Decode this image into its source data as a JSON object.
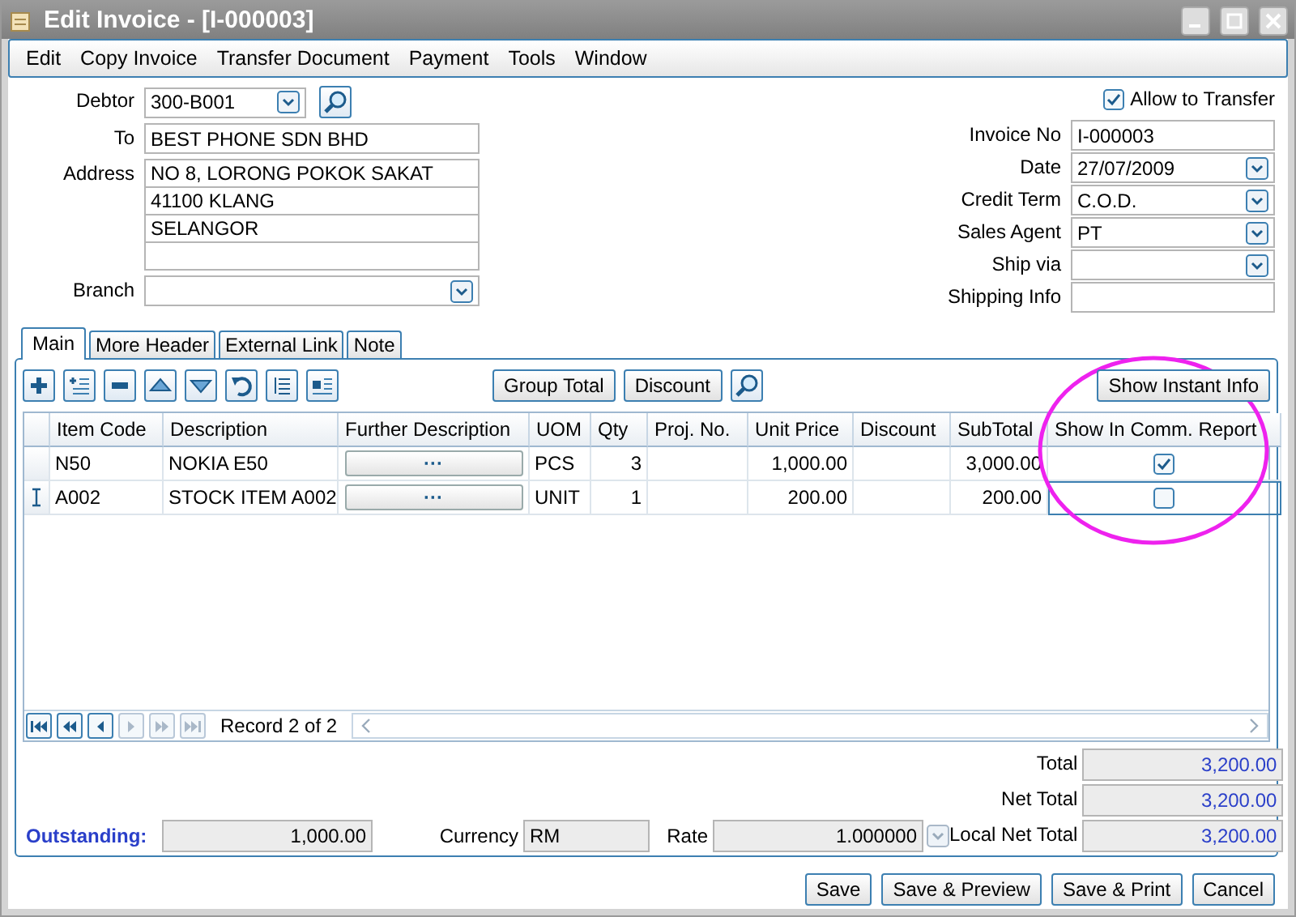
{
  "window": {
    "title": "Edit Invoice - [I-000003]"
  },
  "menu": [
    {
      "label": "Edit"
    },
    {
      "label": "Copy Invoice"
    },
    {
      "label": "Transfer Document"
    },
    {
      "label": "Payment"
    },
    {
      "label": "Tools"
    },
    {
      "label": "Window"
    }
  ],
  "header": {
    "debtor": {
      "label": "Debtor",
      "value": "300-B001"
    },
    "to": {
      "label": "To",
      "value": "BEST PHONE SDN BHD"
    },
    "address": {
      "label": "Address",
      "lines": [
        "NO 8, LORONG POKOK SAKAT",
        "41100 KLANG",
        "SELANGOR"
      ]
    },
    "branch": {
      "label": "Branch"
    },
    "allow_transfer": {
      "label": "Allow to Transfer",
      "checked": true
    },
    "fields": [
      {
        "label": "Invoice No",
        "value": "I-000003",
        "kind": "text"
      },
      {
        "label": "Date",
        "value": "27/07/2009",
        "kind": "combo"
      },
      {
        "label": "Credit Term",
        "value": "C.O.D.",
        "kind": "combo"
      },
      {
        "label": "Sales Agent",
        "value": "PT",
        "kind": "combo"
      },
      {
        "label": "Ship via",
        "kind": "combo"
      },
      {
        "label": "Shipping Info",
        "kind": "text"
      }
    ]
  },
  "tabs": [
    {
      "label": "Main",
      "selected": true
    },
    {
      "label": "More Header",
      "selected": false
    },
    {
      "label": "External Link",
      "selected": false
    },
    {
      "label": "Note",
      "selected": false
    }
  ],
  "toolbar": {
    "icons": [
      {
        "kind": "add"
      },
      {
        "kind": "insert"
      },
      {
        "kind": "remove"
      },
      {
        "kind": "up"
      },
      {
        "kind": "down"
      },
      {
        "kind": "undo"
      },
      {
        "kind": "list"
      },
      {
        "kind": "detail"
      }
    ],
    "buttons": [
      "Group Total",
      "Discount"
    ],
    "info_button": "Show Instant Info"
  },
  "grid": {
    "columns": [
      "Item Code",
      "Description",
      "Further Description",
      "UOM",
      "Qty",
      "Proj. No.",
      "Unit Price",
      "Discount",
      "SubTotal",
      "Show In Comm. Report"
    ],
    "rows": [
      {
        "item_code": "N50",
        "description": "NOKIA E50",
        "further": "···",
        "uom": "PCS",
        "qty": "3",
        "proj_no": "",
        "unit_price": "1,000.00",
        "discount": "",
        "subtotal": "3,000.00",
        "checked": true,
        "current": false
      },
      {
        "item_code": "A002",
        "description": "STOCK ITEM A002",
        "further": "···",
        "uom": "UNIT",
        "qty": "1",
        "proj_no": "",
        "unit_price": "200.00",
        "discount": "",
        "subtotal": "200.00",
        "checked": false,
        "current": true
      }
    ]
  },
  "navigator": {
    "text": "Record 2 of 2",
    "buttons": [
      {
        "kind": "first",
        "disabled": false
      },
      {
        "kind": "prev-page",
        "disabled": false
      },
      {
        "kind": "prev",
        "disabled": false
      },
      {
        "kind": "next",
        "disabled": true
      },
      {
        "kind": "next-page",
        "disabled": true
      },
      {
        "kind": "last",
        "disabled": true
      }
    ]
  },
  "footer": {
    "outstanding": {
      "label": "Outstanding:",
      "value": "1,000.00"
    },
    "currency": {
      "label": "Currency",
      "value": "RM"
    },
    "rate": {
      "label": "Rate",
      "value": "1.000000"
    },
    "totals": [
      {
        "label": "Total",
        "value": "3,200.00"
      },
      {
        "label": "Net Total",
        "value": "3,200.00"
      },
      {
        "label": "Local Net Total",
        "value": "3,200.00"
      }
    ]
  },
  "buttons": [
    "Save",
    "Save & Preview",
    "Save & Print",
    "Cancel"
  ]
}
